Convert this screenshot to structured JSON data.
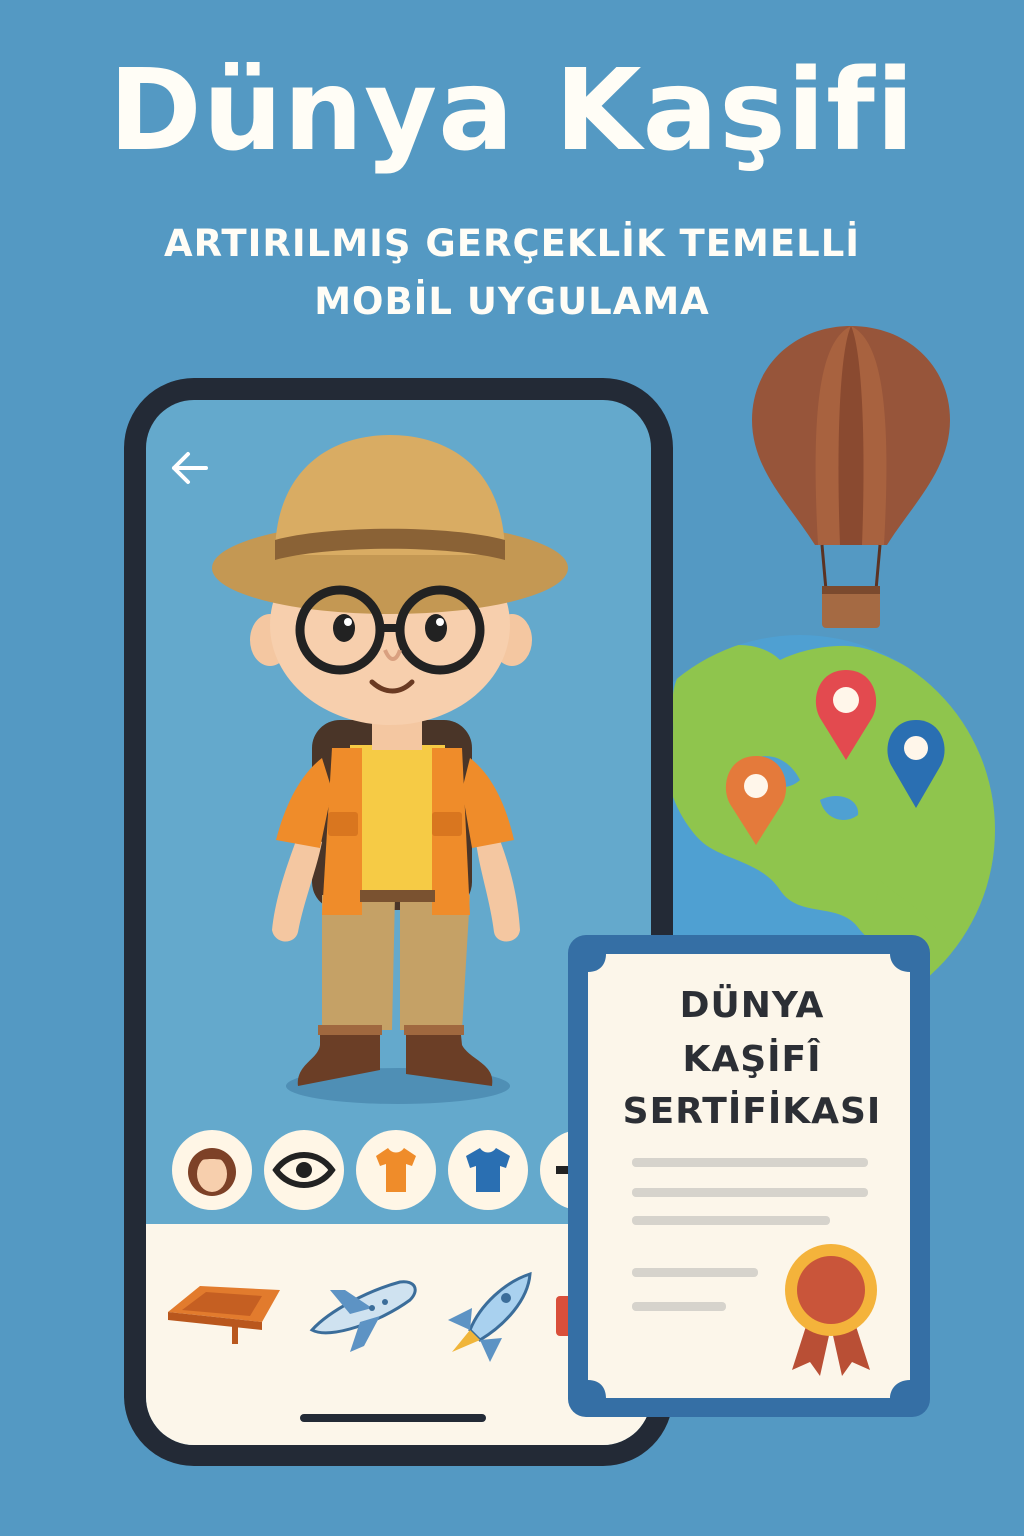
{
  "header": {
    "title": "Dünya Kaşifi",
    "subtitle_line1": "ARTIRILMIŞ GERÇEKLİK TEMELLİ",
    "subtitle_line2": "MOBİL UYGULAMA"
  },
  "phone": {
    "back_icon": "arrow-left-icon",
    "customize_options": [
      {
        "icon": "hair-icon"
      },
      {
        "icon": "eye-icon"
      },
      {
        "icon": "tshirt-icon"
      },
      {
        "icon": "shirt-icon"
      },
      {
        "icon": "glasses-icon"
      }
    ],
    "vehicles": [
      {
        "icon": "magic-carpet-icon"
      },
      {
        "icon": "airplane-icon"
      },
      {
        "icon": "rocket-icon"
      },
      {
        "icon": "hot-air-balloon-basket-icon"
      }
    ]
  },
  "certificate": {
    "line1": "DÜNYA",
    "line2": "KAŞİFÎ",
    "line3": "SERTİFİKASI",
    "seal_icon": "award-ribbon-icon"
  },
  "colors": {
    "background": "#5499c3",
    "phone_frame": "#232a36",
    "phone_screen": "#64a9cc",
    "tray": "#fcf6ea",
    "certificate_border": "#356fa5",
    "balloon": "#97553a",
    "globe_ocean": "#4fa0d2",
    "globe_land": "#8fc54d",
    "pin_red": "#e34a4f",
    "pin_blue": "#2a6fb2",
    "pin_orange": "#e47a3b"
  }
}
